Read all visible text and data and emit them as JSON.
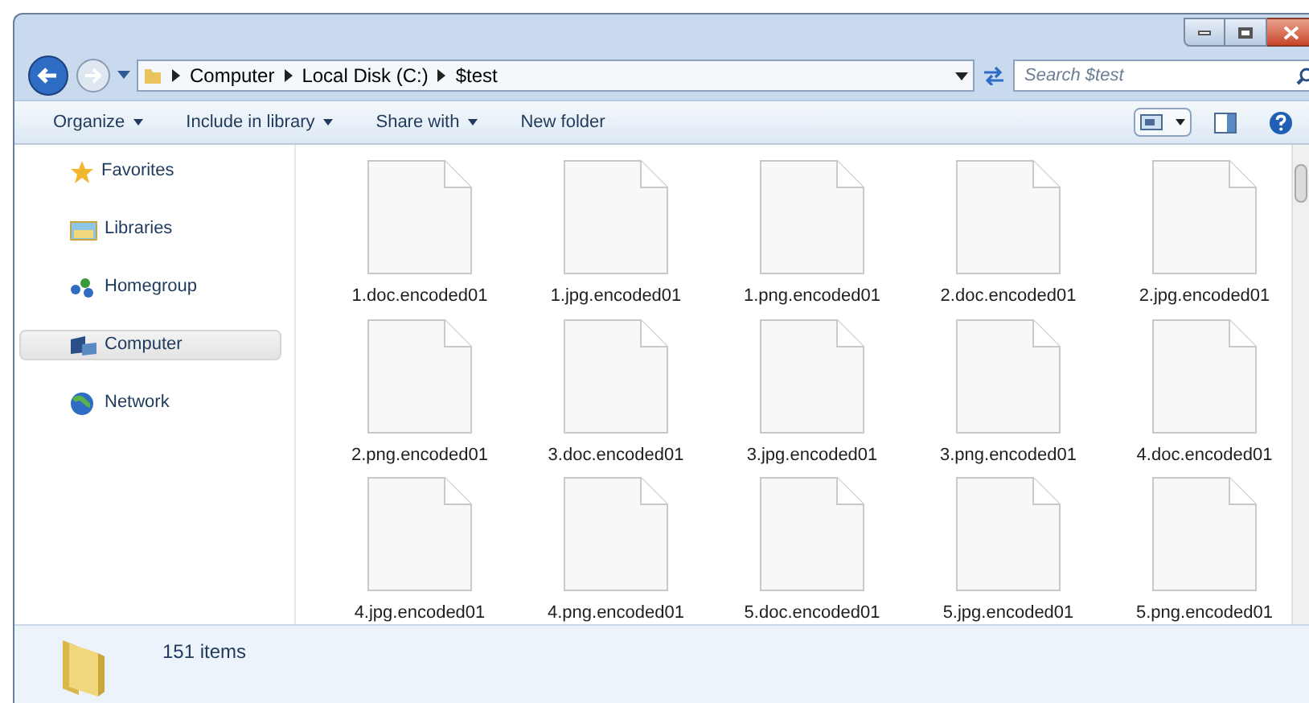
{
  "address_bar": {
    "crumbs": [
      "Computer",
      "Local Disk (C:)",
      "$test"
    ]
  },
  "search": {
    "placeholder": "Search $test"
  },
  "toolbar": {
    "items": [
      "Organize",
      "Include in library",
      "Share with",
      "New folder"
    ],
    "menus": [
      true,
      true,
      true,
      false
    ]
  },
  "sidebar": {
    "items": [
      {
        "label": "Favorites",
        "kind": "star",
        "selected": false
      },
      {
        "label": "Libraries",
        "kind": "library",
        "selected": false
      },
      {
        "label": "Homegroup",
        "kind": "homegroup",
        "selected": false
      },
      {
        "label": "Computer",
        "kind": "computer",
        "selected": true
      },
      {
        "label": "Network",
        "kind": "network",
        "selected": false
      }
    ]
  },
  "files": [
    "1.doc.encoded01",
    "1.jpg.encoded01",
    "1.png.encoded01",
    "2.doc.encoded01",
    "2.jpg.encoded01",
    "2.png.encoded01",
    "3.doc.encoded01",
    "3.jpg.encoded01",
    "3.png.encoded01",
    "4.doc.encoded01",
    "4.jpg.encoded01",
    "4.png.encoded01",
    "5.doc.encoded01",
    "5.jpg.encoded01",
    "5.png.encoded01"
  ],
  "status_bar": {
    "count": "151 items"
  }
}
